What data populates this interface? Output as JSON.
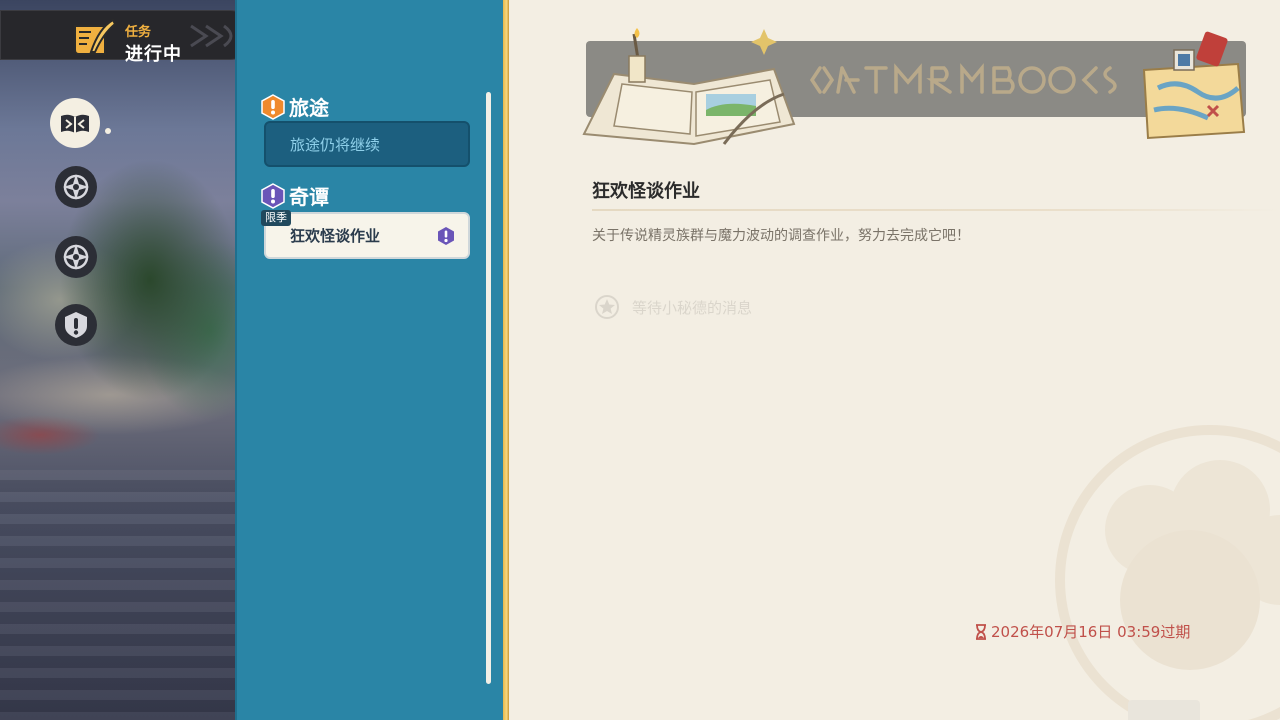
{
  "header": {
    "subtitle": "任务",
    "title": "进行中"
  },
  "nav": {
    "items": [
      {
        "name": "quest-book",
        "active": true
      },
      {
        "name": "compass-a",
        "active": false
      },
      {
        "name": "compass-b",
        "active": false
      },
      {
        "name": "alert",
        "active": false
      }
    ]
  },
  "categories": [
    {
      "title": "旅途",
      "color": "#f08a2c",
      "items": [
        {
          "label": "旅途仍将继续",
          "selected": false
        }
      ]
    },
    {
      "title": "奇谭",
      "color": "#6a55b8",
      "items": [
        {
          "label": "狂欢怪谈作业",
          "selected": true,
          "tag": "限季"
        }
      ]
    }
  ],
  "detail": {
    "title": "狂欢怪谈作业",
    "description": "关于传说精灵族群与魔力波动的调查作业，努力去完成它吧！",
    "objective": "等待小秘德的消息",
    "expiry": "2026年07月16日 03:59过期"
  },
  "colors": {
    "panel_blue": "#2a85a6",
    "paper": "#f3eee3",
    "expiry_red": "#c0504a",
    "accent_gold": "#e8b84a"
  }
}
